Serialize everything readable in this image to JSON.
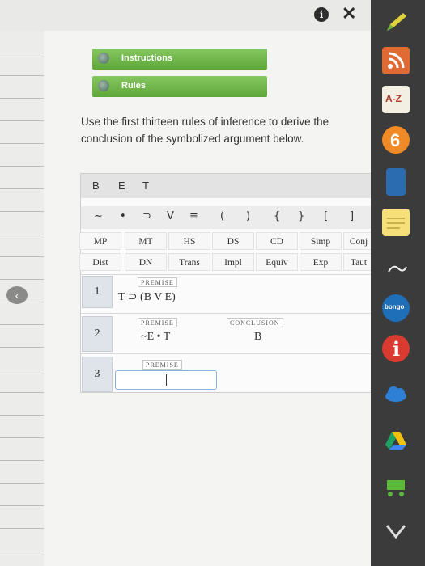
{
  "top": {
    "info_icon": "i",
    "close_icon": "✕"
  },
  "buttons": {
    "instructions": "Instructions",
    "rules": "Rules"
  },
  "prompt": "Use the first thirteen rules of inference to derive the conclusion of the symbolized argument below.",
  "format": [
    "B",
    "E",
    "T"
  ],
  "symbols": [
    "~",
    "•",
    "⊃",
    "V",
    "≡",
    "(",
    ")",
    "{",
    "}",
    "[",
    "]"
  ],
  "rules_row1": [
    "MP",
    "MT",
    "HS",
    "DS",
    "CD",
    "Simp",
    "Conj"
  ],
  "rules_row2": [
    "Dist",
    "DN",
    "Trans",
    "Impl",
    "Equiv",
    "Exp",
    "Taut"
  ],
  "lines": [
    {
      "num": "1",
      "tag": "PREMISE",
      "formula": "T ⊃ (B V E)"
    },
    {
      "num": "2",
      "tag": "PREMISE",
      "formula": "~E • T",
      "conclusion_tag": "CONCLUSION",
      "conclusion": "B"
    },
    {
      "num": "3",
      "tag": "PREMISE",
      "input": ""
    }
  ],
  "dock": {
    "az": "A-Z",
    "bongo": "bongo",
    "info": "i"
  },
  "colors": {
    "green": "#6ab547",
    "dock": "#3b3b3b",
    "panel": "#f4f4f2"
  }
}
